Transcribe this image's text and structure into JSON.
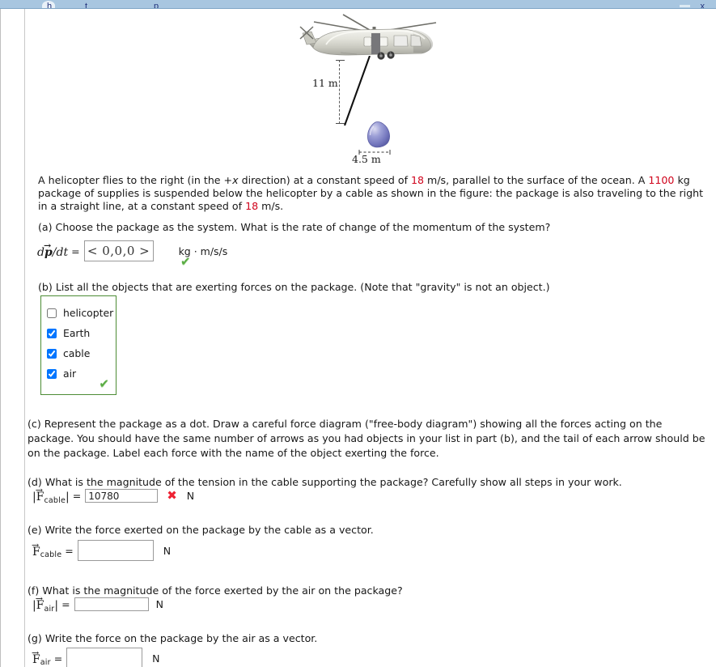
{
  "browser": {
    "ghost_text_1": "h",
    "ghost_text_2": "t",
    "ghost_text_3": "p",
    "ghost_text_right": "x"
  },
  "figure": {
    "alt_name": "helicopter-carrying-suspended-package-diagram",
    "vertical_dimension_label": "11 m",
    "horizontal_dimension_label": "4.5 m",
    "cable_color": "#111111",
    "package_color": "#7b7fc4",
    "helicopter_body_color": "#d8d8cf"
  },
  "problem": {
    "statement_part_1": "A helicopter flies to the right (in the +",
    "statement_x": "x",
    "statement_part_2": " direction) at a constant speed of ",
    "speed_1": "18",
    "statement_part_3": " m/s, parallel to the surface of the ocean. A ",
    "mass": "1100",
    "statement_part_4": " kg package of supplies is suspended below the helicopter by a cable as shown in the figure: the package is also traveling to the right in a straight line, at a constant speed of ",
    "speed_2": "18",
    "statement_part_5": " m/s.",
    "highlight_color": "#d0021b"
  },
  "parts": {
    "a": {
      "prompt": "(a) Choose the package as the system. What is the rate of change of the momentum of the system?",
      "label_d": "d",
      "label_p": "p",
      "label_dt": "/dt",
      "equals": "=",
      "value": "< 0,0,0 >",
      "unit": "kg · m/s/s",
      "mark": "✔",
      "mark_state": "correct"
    },
    "b": {
      "prompt": "(b) List all the objects that are exerting forces on the package. (Note that \"gravity\" is not an object.)",
      "options": [
        {
          "label": "helicopter",
          "checked": false
        },
        {
          "label": "Earth",
          "checked": true
        },
        {
          "label": "cable",
          "checked": true
        },
        {
          "label": "air",
          "checked": true
        }
      ],
      "mark": "✔",
      "mark_state": "correct",
      "border_color": "#4c8c34"
    },
    "c": {
      "prompt": "(c) Represent the package as a dot. Draw a careful force diagram (\"free-body diagram\") showing all the forces acting on the package. You should have the same number of arrows as you had objects in your list in part (b), and the tail of each arrow should be on the package. Label each force with the name of the object exerting the force."
    },
    "d": {
      "prompt": "(d) What is the magnitude of the tension in the cable supporting the package? Carefully show all steps in your work.",
      "label_F": "F",
      "label_sub": "cable",
      "equals": "=",
      "value": "10780",
      "placeholder": "",
      "unit": "N",
      "mark": "✖",
      "mark_state": "incorrect"
    },
    "e": {
      "prompt": "(e) Write the force exerted on the package by the cable as a vector.",
      "label_F": "F",
      "label_sub": "cable",
      "equals": "=",
      "value": "",
      "placeholder": "",
      "unit": "N"
    },
    "f": {
      "prompt": "(f) What is the magnitude of the force exerted by the air on the package?",
      "label_F": "F",
      "label_sub": "air",
      "equals": "=",
      "value": "",
      "placeholder": "",
      "unit": "N"
    },
    "g": {
      "prompt": "(g) Write the force on the package by the air as a vector.",
      "label_F": "F",
      "label_sub": "air",
      "equals": "=",
      "value": "",
      "placeholder": "",
      "unit": "N"
    }
  }
}
